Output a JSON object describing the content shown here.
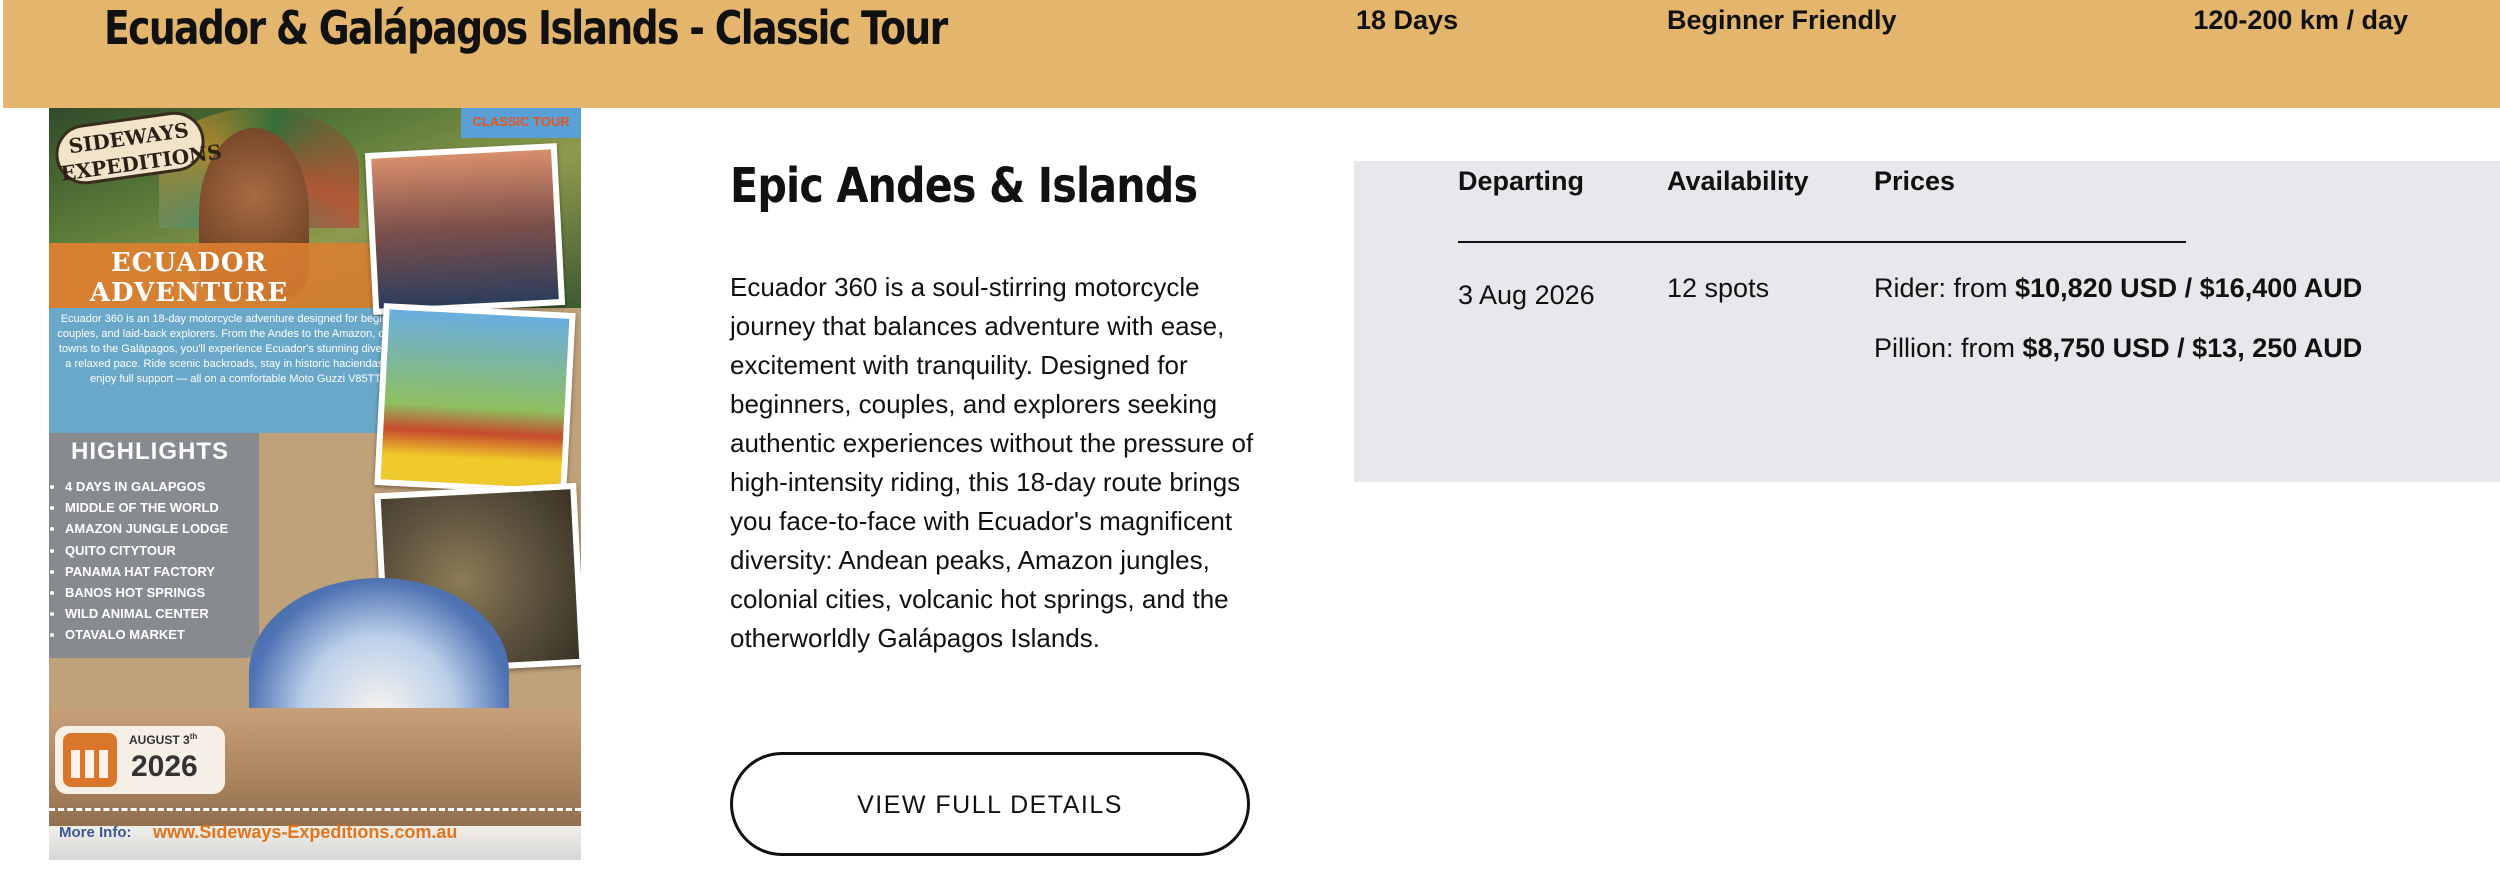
{
  "header": {
    "title": "Ecuador & Galápagos Islands - Classic Tour",
    "duration": "18 Days",
    "level": "Beginner Friendly",
    "distance": "120-200 km / day",
    "background_color": "#e4b56d"
  },
  "poster": {
    "logo_text": "SIDEWAYS EXPEDITIONS",
    "badge": "CLASSIC TOUR",
    "headline": "ECUADOR ADVENTURE",
    "blurb": "Ecuador 360 is an 18-day motorcycle adventure designed for beginners, couples, and laid-back explorers. From the Andes to the Amazon, colonial towns to the Galápagos, you'll experience Ecuador's stunning diversity at a relaxed pace. Ride scenic backroads, stay in historic haciendas, and enjoy full support — all on a comfortable Moto Guzzi V85TT.",
    "highlights_title": "HIGHLIGHTS",
    "highlights": [
      "4 DAYS IN GALAPGOS",
      "MIDDLE OF THE WORLD",
      "AMAZON  JUNGLE LODGE",
      "QUITO CITYTOUR",
      "PANAMA HAT FACTORY",
      "BANOS HOT SPRINGS",
      "WILD ANIMAL CENTER",
      "OTAVALO MARKET"
    ],
    "date_month": "AUGUST 3",
    "date_suffix": "th",
    "date_year": "2026",
    "more_info_label": "More Info:",
    "url": "www.Sideways-Expeditions.com.au"
  },
  "main": {
    "subtitle": "Epic Andes & Islands",
    "description": "Ecuador 360 is a soul-stirring motorcycle journey that balances adventure with ease, excitement with tranquility. Designed for beginners, couples, and explorers seeking authentic experiences without the pressure of high-intensity riding, this 18-day route brings you face-to-face with Ecuador's magnificent diversity: Andean peaks, Amazon jungles, colonial cities, volcanic hot springs, and the otherworldly Galápagos Islands.",
    "button_label": "VIEW FULL DETAILS"
  },
  "table": {
    "headers": {
      "departing": "Departing",
      "availability": "Availability",
      "prices": "Prices"
    },
    "row": {
      "date": "3 Aug 2026",
      "spots": "12 spots",
      "rider_prefix": "Rider: from ",
      "rider_price": "$10,820 USD / $16,400 AUD",
      "pillion_prefix": "Pillion: from ",
      "pillion_price": "$8,750 USD / $13, 250 AUD"
    },
    "panel_color": "#e8e7eb"
  }
}
